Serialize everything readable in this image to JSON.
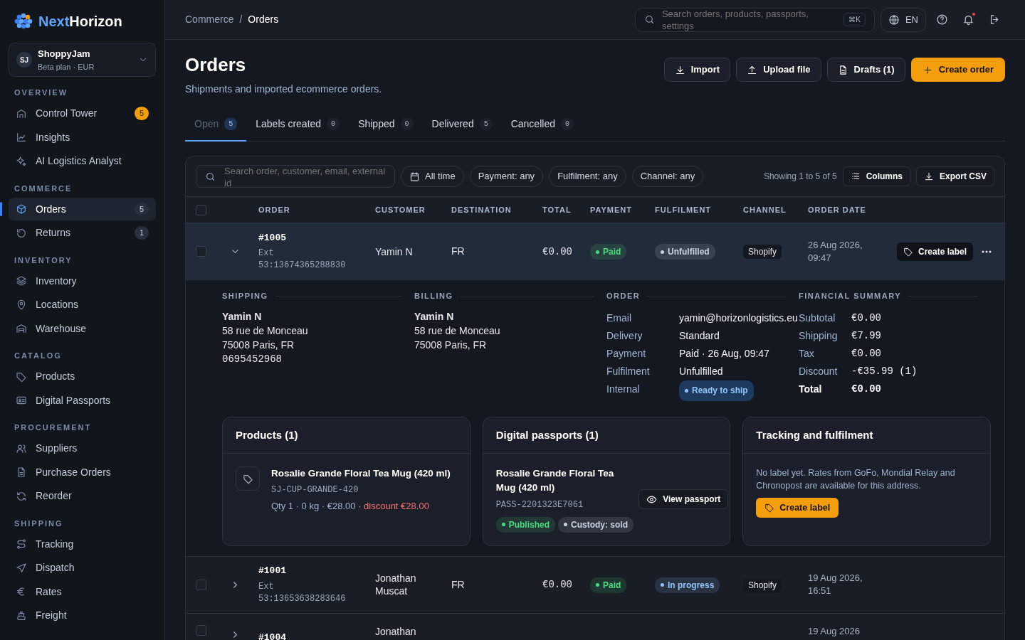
{
  "brand": {
    "first": "Next",
    "second": "Horizon"
  },
  "account": {
    "initials": "SJ",
    "name": "ShoppyJam",
    "plan": "Beta plan · EUR"
  },
  "sidebar": {
    "sections": [
      {
        "title": "OVERVIEW",
        "items": [
          {
            "label": "Control Tower",
            "selected": false,
            "count": "5",
            "color": "#f59e0b"
          },
          {
            "label": "Insights",
            "selected": false
          },
          {
            "label": "AI Logistics Analyst",
            "selected": false
          }
        ]
      },
      {
        "title": "COMMERCE",
        "items": [
          {
            "label": "Orders",
            "selected": true,
            "count": "5",
            "color": "#2a303b"
          },
          {
            "label": "Returns",
            "selected": false,
            "count": "1",
            "color": "#2a303b"
          }
        ]
      },
      {
        "title": "INVENTORY",
        "items": [
          {
            "label": "Inventory",
            "selected": false
          },
          {
            "label": "Locations",
            "selected": false
          },
          {
            "label": "Warehouse",
            "selected": false
          }
        ]
      },
      {
        "title": "CATALOG",
        "items": [
          {
            "label": "Products",
            "selected": false
          },
          {
            "label": "Digital Passports",
            "selected": false
          }
        ]
      },
      {
        "title": "PROCUREMENT",
        "items": [
          {
            "label": "Suppliers",
            "selected": false
          },
          {
            "label": "Purchase Orders",
            "selected": false
          },
          {
            "label": "Reorder",
            "selected": false
          }
        ]
      },
      {
        "title": "SHIPPING",
        "items": [
          {
            "label": "Tracking",
            "selected": false
          },
          {
            "label": "Dispatch",
            "selected": false
          },
          {
            "label": "Rates",
            "selected": false
          },
          {
            "label": "Freight",
            "selected": false
          }
        ]
      }
    ]
  },
  "topbar": {
    "breadcrumb": [
      "Commerce",
      "Orders"
    ],
    "breadcrumb_separator": "/",
    "search": {
      "placeholder": "Search orders, products, passports, settings",
      "shortcut": "⌘K"
    },
    "language": "EN",
    "notifications_unread": true
  },
  "header": {
    "title": "Orders",
    "subtitle": "Shipments and imported ecommerce orders.",
    "actions": [
      {
        "label": "Import",
        "kind": "outline"
      },
      {
        "label": "Upload file",
        "kind": "outline"
      },
      {
        "label": "Drafts (1)",
        "kind": "outline"
      },
      {
        "label": "Create order",
        "kind": "primary"
      }
    ]
  },
  "tabs": [
    {
      "label": "Open",
      "count": "5",
      "selected": true
    },
    {
      "label": "Labels created",
      "count": "0",
      "selected": false
    },
    {
      "label": "Shipped",
      "count": "0",
      "selected": false
    },
    {
      "label": "Delivered",
      "count": "5",
      "selected": false
    },
    {
      "label": "Cancelled",
      "count": "0",
      "selected": false
    }
  ],
  "toolbar": {
    "search": {
      "placeholder": "Search order, customer, email, external id"
    },
    "filters": [
      "All time",
      "Payment: any",
      "Fulfilment: any",
      "Channel: any"
    ],
    "showing": "Showing 1 to 5 of 5",
    "buttons": [
      "Columns",
      "Export CSV"
    ]
  },
  "table": {
    "select_all": {
      "checked": false
    },
    "columns": [
      "ORDER",
      "CUSTOMER",
      "DESTINATION",
      "TOTAL",
      "PAYMENT",
      "FULFILMENT",
      "CHANNEL",
      "ORDER DATE"
    ],
    "rows": [
      {
        "order": "#1005",
        "external": "Ext 53:13674365288830",
        "customer": "Yamin N",
        "destination": "FR",
        "total": "€0.00",
        "payment": {
          "label": "Paid",
          "color": "#4ade80"
        },
        "fulfilment": {
          "label": "Unfulfilled",
          "color": "#cbd5e1"
        },
        "channel": "Shopify",
        "date": "26 Aug 2026, 09:47",
        "action": "Create label",
        "selected": false,
        "expanded": true,
        "detail": {
          "shipping": {
            "title": "SHIPPING",
            "name": "Yamin N",
            "lines": [
              "58 rue de Monceau",
              "75008 Paris, FR"
            ],
            "phone": "0695452968"
          },
          "billing": {
            "title": "BILLING",
            "name": "Yamin N",
            "lines": [
              "58 rue de Monceau",
              "75008 Paris, FR"
            ]
          },
          "order": {
            "title": "ORDER",
            "fields": [
              {
                "label": "Email",
                "value": "yamin@horizonlogistics.eu",
                "kind": "text"
              },
              {
                "label": "Delivery",
                "value": "Standard",
                "kind": "text"
              },
              {
                "label": "Payment",
                "value": "Paid · 26 Aug, 09:47",
                "kind": "text"
              },
              {
                "label": "Fulfilment",
                "value": "Unfulfilled",
                "kind": "text"
              },
              {
                "label": "Internal",
                "value": "Ready to ship",
                "kind": "badge"
              }
            ]
          },
          "financial": {
            "title": "FINANCIAL SUMMARY",
            "rows": [
              {
                "label": "Subtotal",
                "value": "€0.00",
                "bold": false
              },
              {
                "label": "Shipping",
                "value": "€7.99",
                "bold": false
              },
              {
                "label": "Tax",
                "value": "€0.00",
                "bold": false
              },
              {
                "label": "Discount",
                "value": "-€35.99 (1)",
                "bold": false
              },
              {
                "label": "Total",
                "value": "€0.00",
                "bold": true
              }
            ]
          },
          "products": {
            "title": "Products (1)",
            "items": [
              {
                "name": "Rosalie Grande Floral Tea Mug (420 ml)",
                "sku": "SJ-CUP-GRANDE-420",
                "meta": "Qty 1 · 0 kg · €28.00 ·",
                "discount": "discount €28.00"
              }
            ]
          },
          "passports": {
            "title": "Digital passports (1)",
            "items": [
              {
                "name": "Rosalie Grande Floral Tea Mug (420 ml)",
                "code": "PASS-2201323E7061",
                "button": "View passport",
                "tags": [
                  {
                    "label": "Published",
                    "color": "#4ade80"
                  },
                  {
                    "label": "Custody: sold",
                    "color": "#cbd5e1"
                  }
                ]
              }
            ]
          },
          "tracking": {
            "title": "Tracking and fulfilment",
            "text": "No label yet. Rates from GoFo, Mondial Relay and Chronopost are available for this address.",
            "button": "Create label"
          }
        }
      },
      {
        "order": "#1001",
        "external": "Ext 53:13653638283646",
        "customer": "Jonathan Muscat",
        "destination": "FR",
        "total": "€0.00",
        "payment": {
          "label": "Paid",
          "color": "#4ade80"
        },
        "fulfilment": {
          "label": "In progress",
          "color": "#93c5fd"
        },
        "channel": "Shopify",
        "date": "19 Aug 2026, 16:51",
        "selected": false,
        "expanded": false
      },
      {
        "order": "#1004",
        "customer": "Jonathan",
        "date": "19 Aug 2026",
        "selected": false,
        "expanded": false
      }
    ]
  }
}
